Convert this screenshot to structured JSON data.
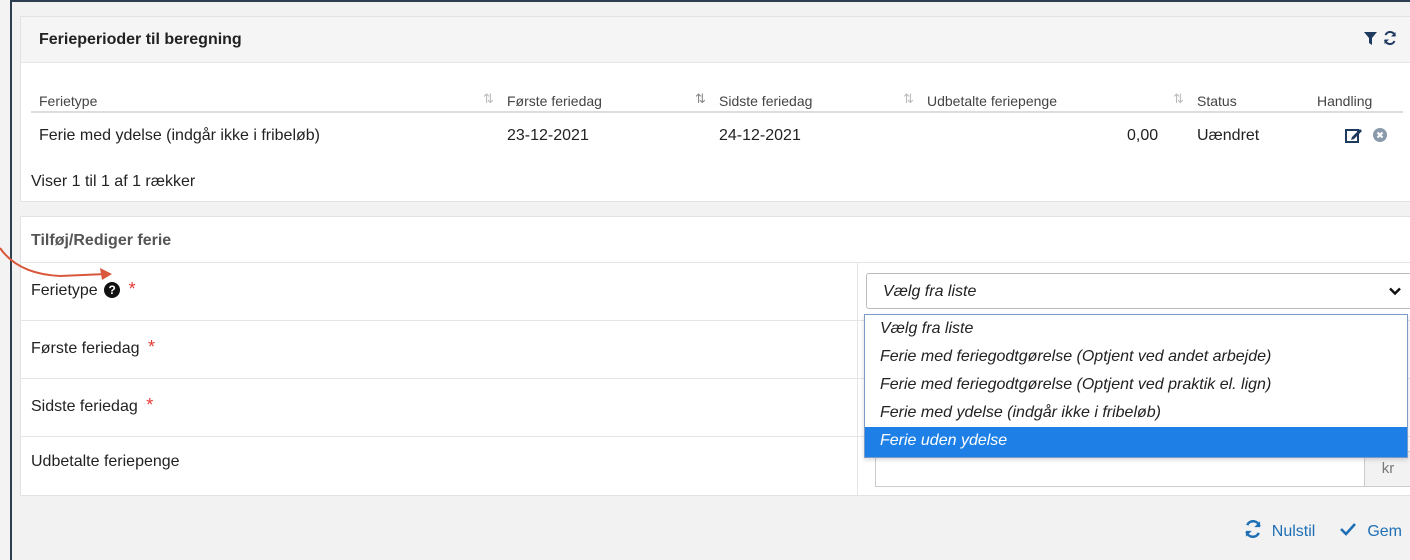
{
  "table_panel": {
    "title": "Ferieperioder til beregning",
    "columns": [
      "Ferietype",
      "Første feriedag",
      "Sidste feriedag",
      "Udbetalte feriepenge",
      "Status",
      "Handling"
    ],
    "rows": [
      {
        "ferietype": "Ferie med ydelse (indgår ikke i fribeløb)",
        "forste": "23-12-2021",
        "sidste": "24-12-2021",
        "udbetalt": "0,00",
        "status": "Uændret"
      }
    ],
    "summary": "Viser 1 til 1 af 1 rækker"
  },
  "form_panel": {
    "title": "Tilføj/Rediger ferie",
    "fields": {
      "ferietype": "Ferietype",
      "forste": "Første feriedag",
      "sidste": "Sidste feriedag",
      "udbetalt": "Udbetalte feriepenge"
    },
    "required_mark": "*",
    "help_glyph": "?",
    "select_value": "Vælg fra liste",
    "options": [
      "Vælg fra liste",
      "Ferie med feriegodtgørelse (Optjent ved andet arbejde)",
      "Ferie med feriegodtgørelse (Optjent ved praktik el. lign)",
      "Ferie med ydelse (indgår ikke i fribeløb)",
      "Ferie uden ydelse"
    ],
    "highlighted_option": "Ferie uden ydelse",
    "currency": "kr"
  },
  "footer": {
    "reset": "Nulstil",
    "save": "Gem"
  },
  "colors": {
    "accent": "#1f6fb5",
    "highlight": "#1e80e6",
    "required": "#e53935",
    "annotation_arrow": "#d9573b"
  }
}
